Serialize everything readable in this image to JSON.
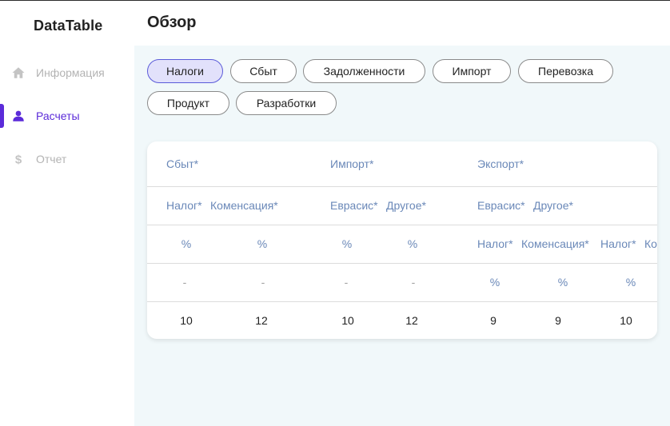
{
  "sidebar": {
    "brand": "DataTable",
    "items": [
      {
        "label": "Информация",
        "icon": "home-icon",
        "active": false
      },
      {
        "label": "Расчеты",
        "icon": "user-icon",
        "active": true
      },
      {
        "label": "Отчет",
        "icon": "dollar-icon",
        "active": false
      }
    ]
  },
  "header": {
    "title": "Обзор"
  },
  "tabs": [
    {
      "label": "Налоги",
      "active": true
    },
    {
      "label": "Сбыт"
    },
    {
      "label": "Задолженности"
    },
    {
      "label": "Импорт"
    },
    {
      "label": "Перевозка"
    },
    {
      "label": "Продукт"
    },
    {
      "label": "Разработки"
    }
  ],
  "table": {
    "row1": [
      "Сбыт*",
      "Импорт*",
      "Экспорт*"
    ],
    "row2": [
      "Налог*",
      "Коменсация*",
      "Еврасис*",
      "Другое*",
      "Еврасис*",
      "Другое*"
    ],
    "row3": [
      "%",
      "%",
      "%",
      "%",
      "Налог*",
      "Коменсация*",
      "Налог*",
      "Ко"
    ],
    "row4": [
      "-",
      "-",
      "-",
      "-",
      "%",
      "%",
      "%"
    ],
    "row5": [
      "10",
      "12",
      "10",
      "12",
      "9",
      "9",
      "10"
    ]
  },
  "colors": {
    "accent": "#5b2bd9",
    "header_text": "#6a88b8",
    "active_tab_bg": "#e2e1fb",
    "main_bg": "#f1f8fa"
  }
}
